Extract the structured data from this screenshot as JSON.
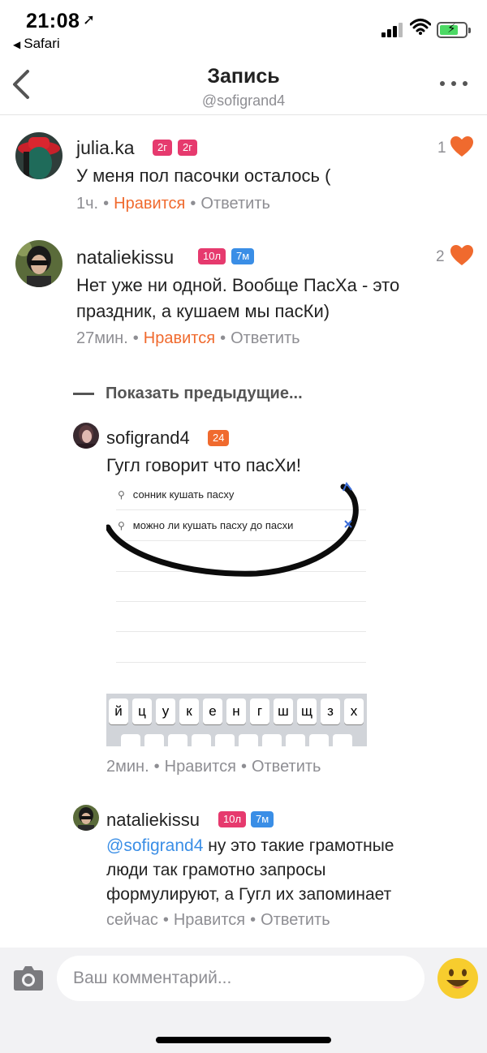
{
  "status_bar": {
    "time": "21:08",
    "back_app": "Safari",
    "battery_color": "#4cd964"
  },
  "header": {
    "title": "Запись",
    "subtitle": "@sofigrand4"
  },
  "comments": [
    {
      "username": "julia.ka",
      "badges": [
        "2г",
        "2г"
      ],
      "text": "У меня пол пасочки осталось (",
      "time": "1ч.",
      "like_label": "Нравится",
      "reply_label": "Ответить",
      "like_count": "1",
      "liked": true
    },
    {
      "username": "nataliekissu",
      "badges": [
        "10л",
        "7м"
      ],
      "text_line1": "Нет уже ни одной. Вообще ПасХа - это",
      "text_line2": "праздник,  а кушаем мы пасКи)",
      "time": "27мин.",
      "like_label": "Нравится",
      "reply_label": "Ответить",
      "like_count": "2",
      "liked": true
    }
  ],
  "show_previous": "Показать предыдущие...",
  "replies": [
    {
      "username": "sofigrand4",
      "badges": [
        "24"
      ],
      "text": "Гугл говорит что пасХи!",
      "image": {
        "suggestions": [
          "сонник кушать пасху",
          "можно ли кушать пасху до пасхи"
        ],
        "keyboard_keys": [
          "й",
          "ц",
          "у",
          "к",
          "е",
          "н",
          "г",
          "ш",
          "щ",
          "з",
          "х"
        ]
      },
      "time": "2мин.",
      "like_label": "Нравится",
      "reply_label": "Ответить"
    },
    {
      "username": "nataliekissu",
      "badges": [
        "10л",
        "7м"
      ],
      "mention": "@sofigrand4",
      "text_line1": " ну это такие грамотные",
      "text_line2": "люди так грамотно запросы",
      "text_line3": "формулируют,  а Гугл их запоминает",
      "time": "сейчас",
      "like_label": "Нравится",
      "reply_label": "Ответить"
    }
  ],
  "composer": {
    "placeholder": "Ваш комментарий..."
  },
  "colors": {
    "accent": "#f06a2e",
    "badge_pink": "#e63a6e",
    "badge_blue": "#3a8ee6",
    "badge_orange": "#f06a2e",
    "mention": "#3a8ee6"
  },
  "icons": [
    "back-chevron-icon",
    "more-icon",
    "heart-icon",
    "search-icon",
    "camera-icon",
    "smiley-icon"
  ]
}
